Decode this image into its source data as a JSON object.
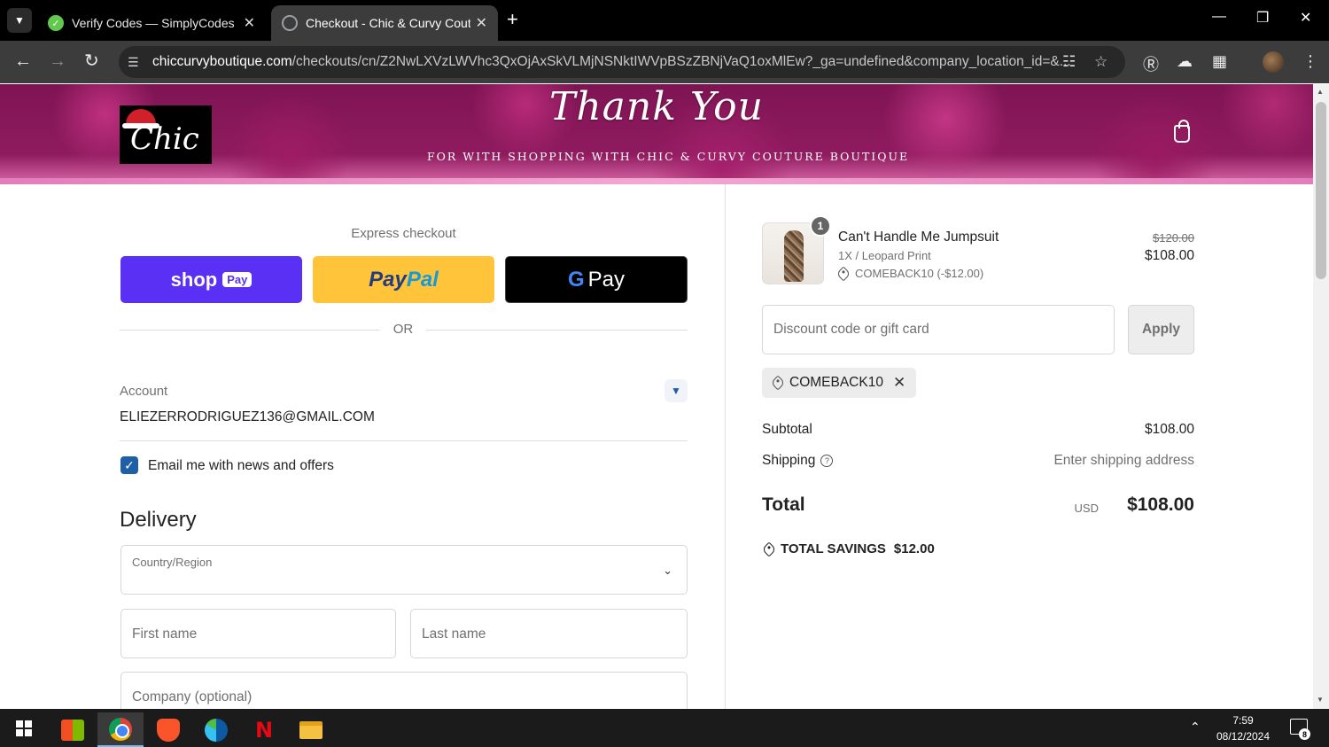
{
  "browser": {
    "tabs": [
      {
        "title": "Verify Codes — SimplyCodes",
        "active": false
      },
      {
        "title": "Checkout - Chic & Curvy Couture",
        "active": true
      }
    ],
    "url_domain": "chiccurvyboutique.com",
    "url_path": "/checkouts/cn/Z2NwLXVzLWVhc3QxOjAxSkVLMjNSNktIWVpBSzZBNjVaQ1oxMlEw?_ga=undefined&company_location_id=&..."
  },
  "banner": {
    "logo_text": "Chic",
    "heading": "Thank You",
    "subheading": "FOR WITH SHOPPING WITH CHIC & CURVY COUTURE BOUTIQUE"
  },
  "checkout": {
    "express_title": "Express checkout",
    "shop_pay_label": "shop",
    "shop_pay_chip": "Pay",
    "paypal_part1": "Pay",
    "paypal_part2": "Pal",
    "gpay_g": "G",
    "gpay_label": "Pay",
    "or_text": "OR",
    "account_label": "Account",
    "account_email": "ELIEZERRODRIGUEZ136@GMAIL.COM",
    "newsletter_label": "Email me with news and offers",
    "newsletter_checked": true,
    "delivery_heading": "Delivery",
    "country_label": "Country/Region",
    "first_name_placeholder": "First name",
    "last_name_placeholder": "Last name",
    "company_placeholder": "Company (optional)"
  },
  "order": {
    "item": {
      "quantity": "1",
      "name": "Can't Handle Me Jumpsuit",
      "variant": "1X / Leopard Print",
      "discount": "COMEBACK10 (-$12.00)",
      "original_price": "$120.00",
      "price": "$108.00"
    },
    "discount_placeholder": "Discount code or gift card",
    "apply_label": "Apply",
    "applied_code": "COMEBACK10",
    "subtotal_label": "Subtotal",
    "subtotal_value": "$108.00",
    "shipping_label": "Shipping",
    "shipping_value": "Enter shipping address",
    "total_label": "Total",
    "currency": "USD",
    "total_value": "$108.00",
    "savings_label": "TOTAL SAVINGS",
    "savings_value": "$12.00"
  },
  "taskbar": {
    "time": "7:59",
    "date": "08/12/2024",
    "notification_count": "8"
  },
  "colors": {
    "shop_pay": "#5a31f4",
    "paypal": "#ffc439",
    "accent": "#1f5fa5"
  }
}
